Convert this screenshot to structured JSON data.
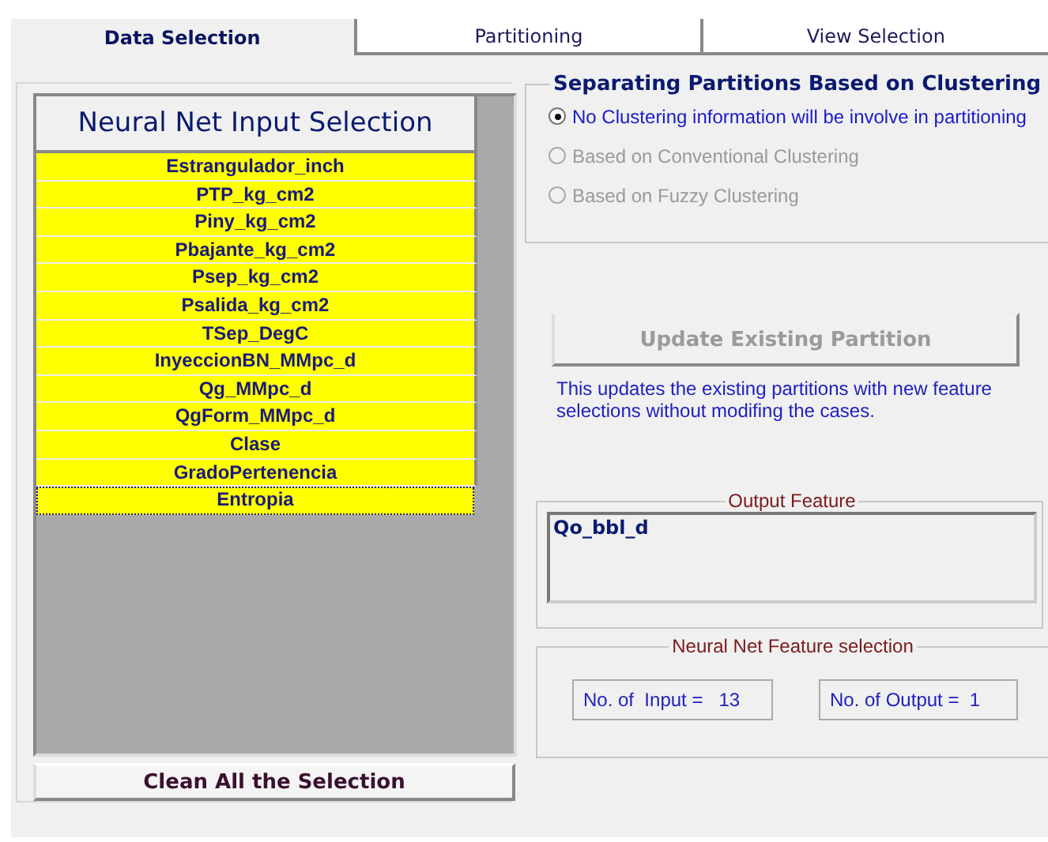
{
  "tabs": [
    {
      "label": "Data Selection",
      "selected": true
    },
    {
      "label": "Partitioning",
      "selected": false
    },
    {
      "label": "View Selection",
      "selected": false
    }
  ],
  "input_list": {
    "title": "Neural Net Input Selection",
    "items": [
      {
        "label": "Estrangulador_inch",
        "selected": true,
        "focused": false
      },
      {
        "label": "PTP_kg_cm2",
        "selected": true,
        "focused": false
      },
      {
        "label": "Piny_kg_cm2",
        "selected": true,
        "focused": false
      },
      {
        "label": "Pbajante_kg_cm2",
        "selected": true,
        "focused": false
      },
      {
        "label": "Psep_kg_cm2",
        "selected": true,
        "focused": false
      },
      {
        "label": "Psalida_kg_cm2",
        "selected": true,
        "focused": false
      },
      {
        "label": "TSep_DegC",
        "selected": true,
        "focused": false
      },
      {
        "label": "InyeccionBN_MMpc_d",
        "selected": true,
        "focused": false
      },
      {
        "label": "Qg_MMpc_d",
        "selected": true,
        "focused": false
      },
      {
        "label": "QgForm_MMpc_d",
        "selected": true,
        "focused": false
      },
      {
        "label": "Clase",
        "selected": true,
        "focused": false
      },
      {
        "label": "GradoPertenencia",
        "selected": true,
        "focused": false
      },
      {
        "label": "Entropia",
        "selected": true,
        "focused": true
      }
    ]
  },
  "clean_button": "Clean All the Selection",
  "partition_group": {
    "title": "Separating Partitions Based on Clustering",
    "options": [
      {
        "label": "No Clustering information will  be involve in partitioning",
        "selected": true,
        "disabled": false
      },
      {
        "label": "Based on Conventional Clustering",
        "selected": false,
        "disabled": true
      },
      {
        "label": "Based on Fuzzy Clustering",
        "selected": false,
        "disabled": true
      }
    ]
  },
  "update_button": {
    "label": "Update Existing Partition",
    "disabled": true
  },
  "update_note": "This updates the existing partitions with new feature selections without modifing the cases.",
  "output_feature": {
    "title": "Output Feature",
    "value": "Qo_bbl_d"
  },
  "feature_selection": {
    "title": "Neural Net Feature selection",
    "input_count": "No. of  Input =   13",
    "output_count": "No. of Output =  1"
  }
}
